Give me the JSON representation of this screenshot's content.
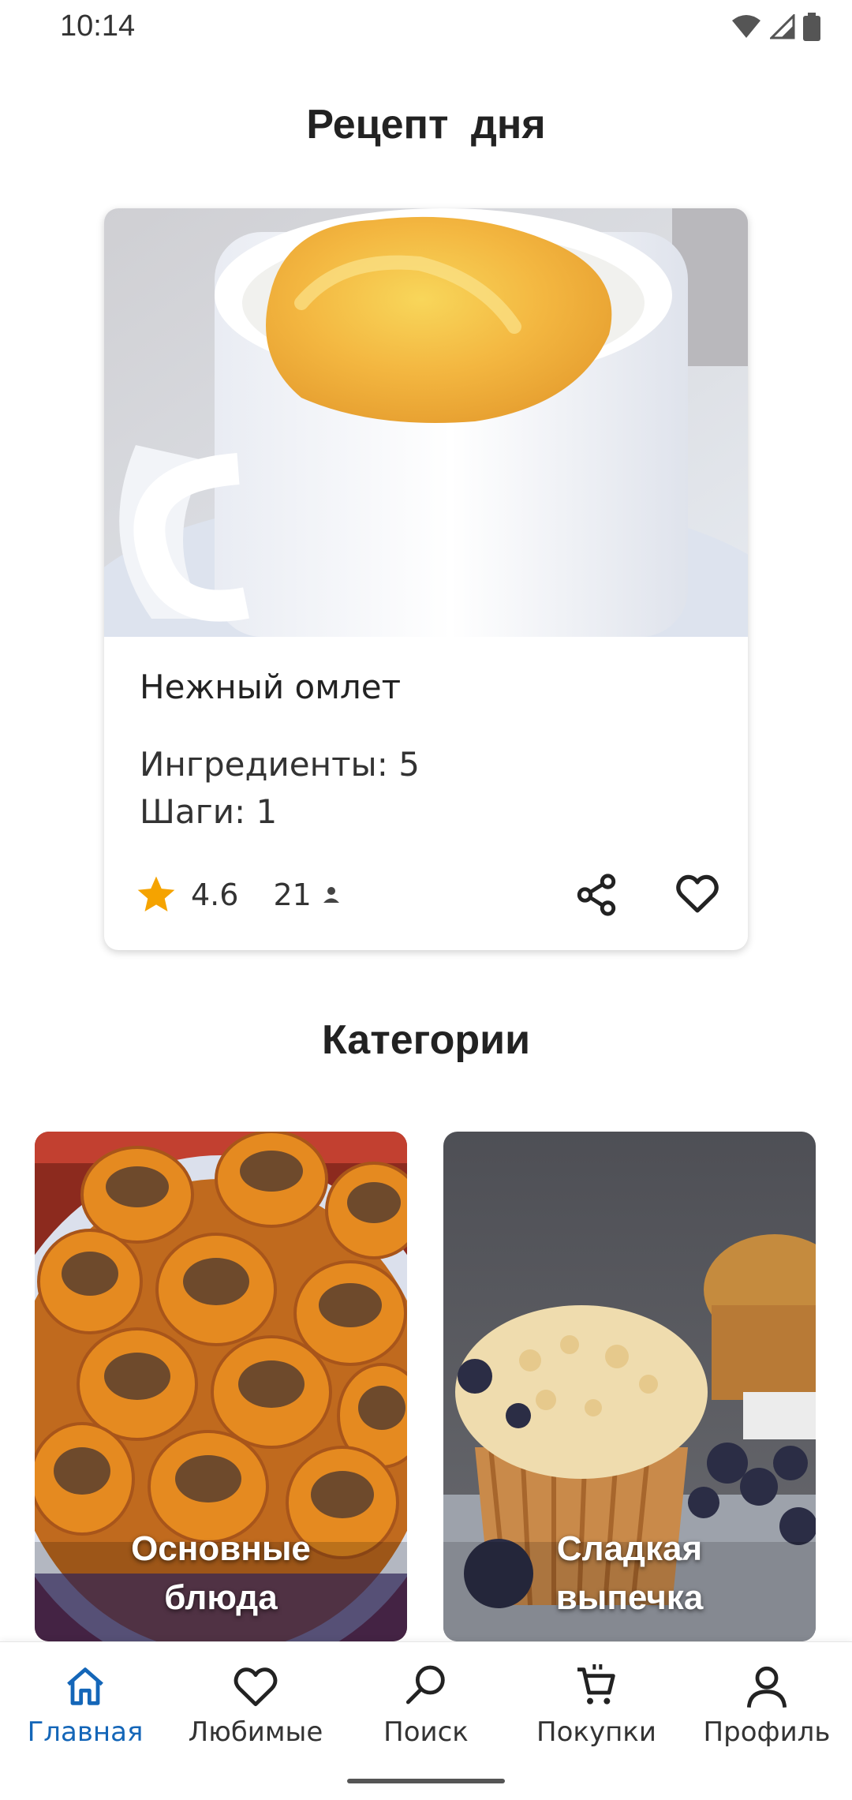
{
  "status_bar": {
    "time": "10:14",
    "icons": [
      "wifi-icon",
      "signal-icon",
      "battery-icon"
    ]
  },
  "page_title": "Рецепт дня",
  "recipe": {
    "image": "omelette-in-mug-photo",
    "name": "Нежный омлет",
    "ingredients": "Ингредиенты: 5",
    "steps": "Шаги: 1",
    "rating": "4.6",
    "reviews": "21",
    "icons": [
      "star-icon",
      "person-icon",
      "share-icon",
      "heart-icon"
    ]
  },
  "categories_title": "Категории",
  "categories": [
    {
      "label_line1": "Основные",
      "label_line2": "блюда",
      "image": "stuffed-potatoes-photo"
    },
    {
      "label_line1": "Сладкая",
      "label_line2": "выпечка",
      "image": "blueberry-muffins-photo"
    }
  ],
  "nav": {
    "items": [
      {
        "label": "Главная",
        "icon": "home-icon",
        "active": true
      },
      {
        "label": "Любимые",
        "icon": "heart-icon",
        "active": false
      },
      {
        "label": "Поиск",
        "icon": "search-icon",
        "active": false
      },
      {
        "label": "Покупки",
        "icon": "cart-icon",
        "active": false
      },
      {
        "label": "Профиль",
        "icon": "profile-icon",
        "active": false
      }
    ]
  },
  "colors": {
    "accent": "#1466b8",
    "star": "#f5a300",
    "text": "#222222",
    "nav_inactive": "#333333"
  }
}
